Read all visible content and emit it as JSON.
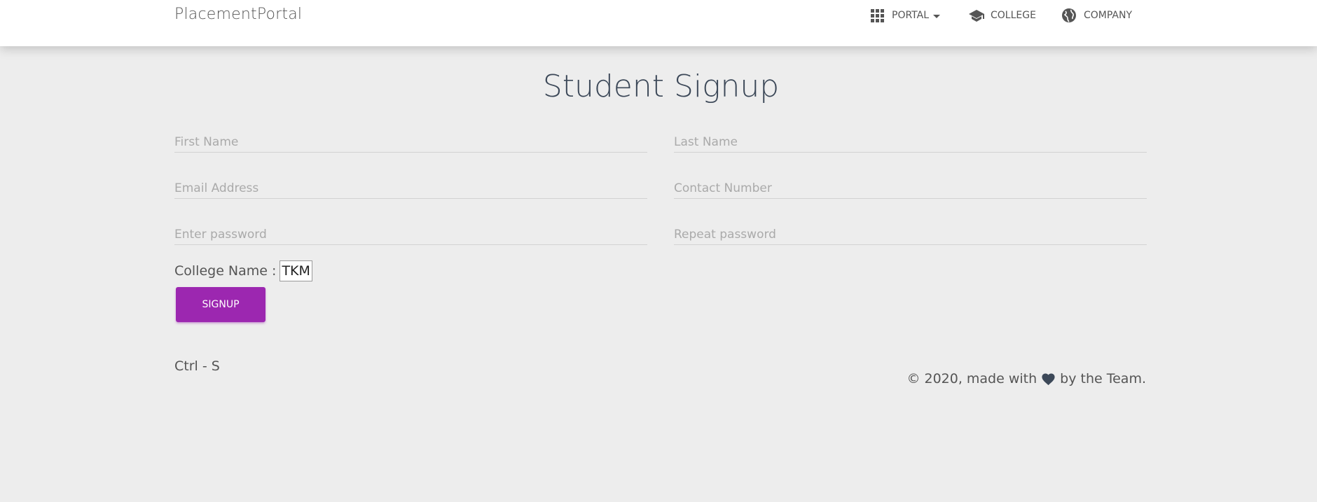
{
  "navbar": {
    "brand": "PlacementPortal",
    "items": [
      {
        "label": "PORTAL",
        "icon": "apps-grid-icon"
      },
      {
        "label": "COLLEGE",
        "icon": "graduation-cap-icon"
      },
      {
        "label": "COMPANY",
        "icon": "globe-icon"
      }
    ]
  },
  "page": {
    "title": "Student Signup"
  },
  "form": {
    "first_name": {
      "placeholder": "First Name",
      "value": ""
    },
    "last_name": {
      "placeholder": "Last Name",
      "value": ""
    },
    "email": {
      "placeholder": "Email Address",
      "value": ""
    },
    "contact": {
      "placeholder": "Contact Number",
      "value": ""
    },
    "password": {
      "placeholder": "Enter password",
      "value": ""
    },
    "repeat_password": {
      "placeholder": "Repeat password",
      "value": ""
    },
    "college_label": "College Name :",
    "college_value": "TKM",
    "signup_label": "SIGNUP"
  },
  "footer": {
    "shortcut": "Ctrl - S",
    "credit_prefix": "© 2020, made with",
    "credit_suffix": "by the Team."
  },
  "colors": {
    "primary": "#9c27b0",
    "background": "#ededed",
    "title": "#3c4858"
  }
}
